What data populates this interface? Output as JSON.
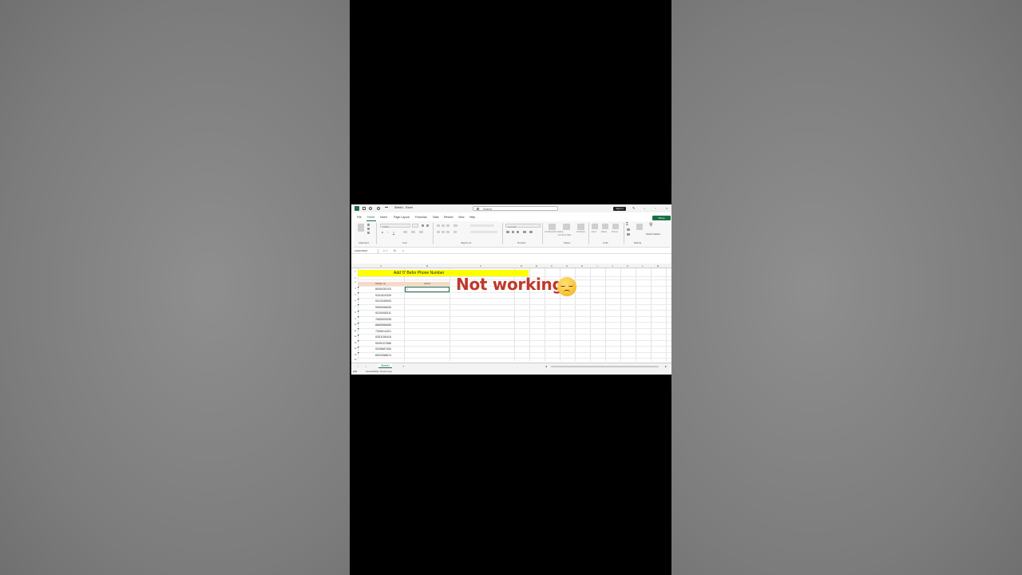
{
  "window": {
    "title": "Sheet1 - Excel",
    "search_placeholder": "Search",
    "signin_label": "Sign in",
    "share_label": "Share"
  },
  "menu": [
    "File",
    "Home",
    "Insert",
    "Page Layout",
    "Formulas",
    "Data",
    "Review",
    "View",
    "Help"
  ],
  "ribbon": {
    "groups": [
      "Clipboard",
      "Font",
      "Alignment",
      "Number",
      "Styles",
      "Cells",
      "Editing"
    ],
    "font_name": "Calibri",
    "number_format": "General",
    "styles_buttons": [
      "Conditional Formatting",
      "Format as Table",
      "Cell Styles"
    ],
    "cells_buttons": [
      "Insert",
      "Delete",
      "Format"
    ],
    "find_select": "Find & Select"
  },
  "formula_bar": {
    "name_box": "AUDIOSKIP",
    "fx": "fx",
    "content": "="
  },
  "columns": [
    "A",
    "B",
    "C",
    "D",
    "E",
    "F",
    "G",
    "H",
    "I",
    "J",
    "K",
    "L",
    "M"
  ],
  "rows": [
    "1",
    "2",
    "3",
    "4",
    "5",
    "6",
    "7",
    "8",
    "9",
    "10",
    "11",
    "12",
    "13",
    "14",
    "15",
    "16"
  ],
  "sheet": {
    "title_cell": "Add '0' Befor Phone Number",
    "header_a": "Mobile no.",
    "header_b": "Add 0",
    "active_cell_value": "=",
    "numbers": [
      "8005430103",
      "9341819339",
      "9313345993",
      "9999096635",
      "9310008311",
      "7665500538",
      "8685986685",
      "7395914321",
      "6351155416",
      "9099107686",
      "9328687454",
      "8929288674"
    ]
  },
  "sheet_tabs": {
    "active": "Sheet1",
    "add": "+"
  },
  "status": {
    "mode": "Edit",
    "accessibility": "Accessibility: Good to go"
  },
  "overlay": {
    "caption": "Not working",
    "emoji": "pensive-face"
  },
  "colors": {
    "excel_green": "#1d6f42",
    "title_highlight": "#ffff00",
    "header_fill": "#f8d9c8",
    "caption_red": "#c0392b"
  }
}
